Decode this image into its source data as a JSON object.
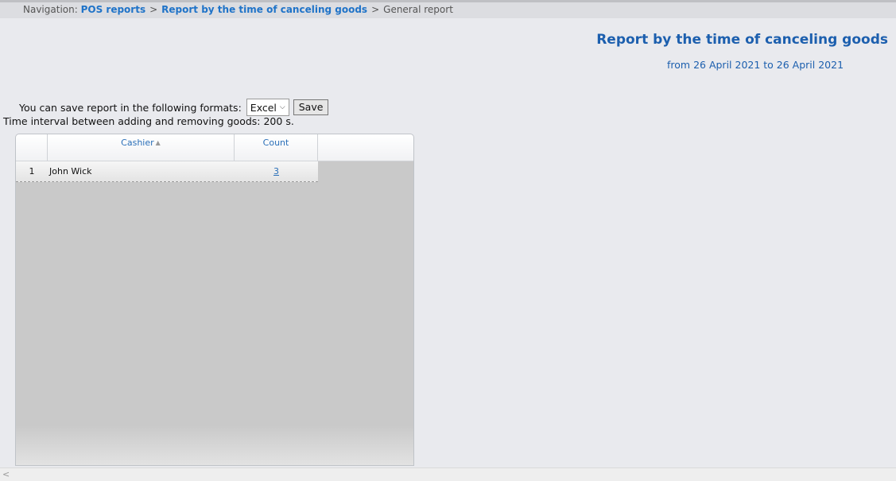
{
  "breadcrumb": {
    "prefix": "Navigation:",
    "items": [
      "POS reports",
      "Report by the time of canceling goods"
    ],
    "current": "General report",
    "separator": ">"
  },
  "report": {
    "title": "Report by the time of canceling goods",
    "period": "from 26 April 2021 to 26 April 2021"
  },
  "export": {
    "label": "You can save report in the following formats:",
    "format": "Excel",
    "save_label": "Save"
  },
  "interval_text": "Time interval between adding and removing goods: 200 s.",
  "table": {
    "columns": [
      "",
      "Cashier",
      "Count"
    ],
    "rows": [
      {
        "num": "1",
        "cashier": "John Wick",
        "count": "3"
      }
    ]
  },
  "icons": {
    "sort": "sort-icon",
    "dropdown": "chevron-down-icon",
    "scroll_left": "chevron-left-icon"
  },
  "colors": {
    "accent": "#1c5fae",
    "link": "#1f73c8",
    "background": "#e9eaee",
    "grid_fill": "#c9c9c9"
  }
}
